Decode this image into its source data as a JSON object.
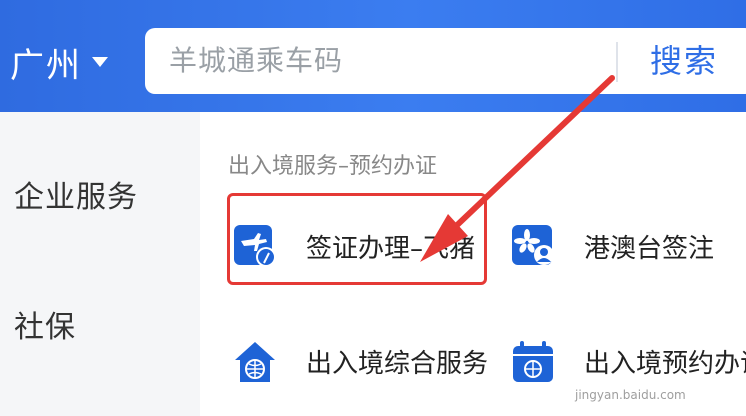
{
  "header": {
    "city": "广州",
    "search_placeholder": "羊城通乘车码",
    "search_button": "搜索"
  },
  "sidebar": {
    "items": [
      {
        "label": "企业服务"
      },
      {
        "label": "社保"
      }
    ]
  },
  "main": {
    "section_title": "出入境服务–预约办证",
    "services": [
      {
        "label": "签证办理–飞猪",
        "icon": "plane-clock-icon"
      },
      {
        "label": "港澳台签注",
        "icon": "flower-user-icon"
      },
      {
        "label": "出入境综合服务",
        "icon": "house-globe-icon"
      },
      {
        "label": "出入境预约办证",
        "icon": "calendar-globe-icon"
      }
    ]
  },
  "colors": {
    "primary": "#2f6ee6",
    "highlight": "#e53935",
    "icon_bg": "#1e63d6"
  },
  "watermark": "jingyan.baidu.com"
}
